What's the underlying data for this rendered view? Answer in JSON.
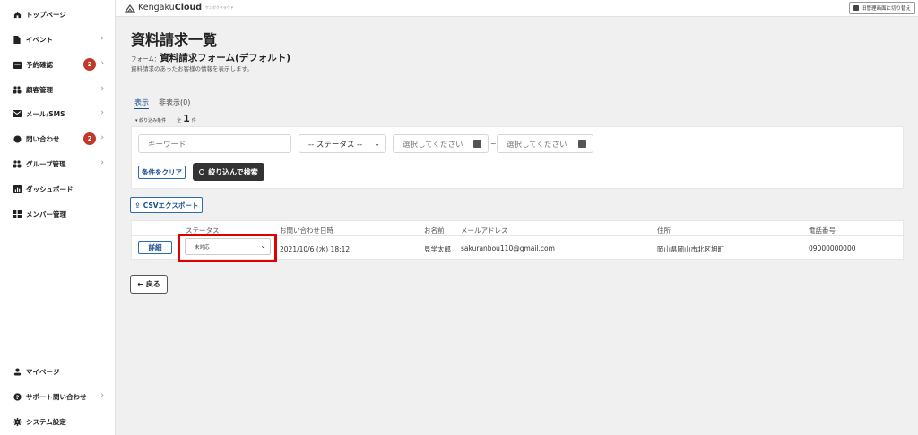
{
  "sidebar": {
    "items": [
      {
        "label": "トップページ",
        "icon": "home-icon"
      },
      {
        "label": "イベント",
        "icon": "document-icon"
      },
      {
        "label": "予約確認",
        "icon": "calendar-icon",
        "badge": "2"
      },
      {
        "label": "顧客管理",
        "icon": "users-icon"
      },
      {
        "label": "メール/SMS",
        "icon": "mail-icon"
      },
      {
        "label": "問い合わせ",
        "icon": "inquiry-icon",
        "badge": "2"
      },
      {
        "label": "グループ管理",
        "icon": "group-icon"
      },
      {
        "label": "ダッシュボード",
        "icon": "dashboard-icon"
      },
      {
        "label": "メンバー管理",
        "icon": "members-icon"
      }
    ],
    "bottom_items": [
      {
        "label": "マイページ",
        "icon": "person-icon"
      },
      {
        "label": "サポート問い合わせ",
        "icon": "help-icon"
      },
      {
        "label": "システム設定",
        "icon": "gear-icon"
      }
    ],
    "chevron": "›"
  },
  "header": {
    "brand_regular": "Kengaku",
    "brand_bold": "Cloud",
    "brand_kana": "ケンガククラウド",
    "switch_label": "旧管理画面に切り替え"
  },
  "main": {
    "title": "資料請求一覧",
    "form_prefix": "フォーム：",
    "form_name": "資料請求フォーム(デフォルト)",
    "description": "資料請求のあったお客様の情報を表示します。",
    "tabs": [
      {
        "label": "表示"
      },
      {
        "label": "非表示(0)"
      }
    ],
    "filter_toggle": "▾ 絞り込み条件",
    "count_prefix": "全",
    "count": "1",
    "count_suffix": "件",
    "filters": {
      "keyword_placeholder": "キーワード",
      "status_value": "-- ステータス --",
      "date_from_placeholder": "選択してください",
      "date_to_placeholder": "選択してください",
      "tilde": "~",
      "clear_label": "条件をクリア",
      "search_label": "絞り込んで検索"
    },
    "csv_label": "CSVエクスポート",
    "table": {
      "headers": [
        "ステータス",
        "お問い合わせ日時",
        "お名前",
        "メールアドレス",
        "住所",
        "電話番号"
      ],
      "rows": [
        {
          "detail_label": "詳細",
          "status": "未対応",
          "datetime": "2021/10/6 (水) 18:12",
          "name": "見学太郎",
          "email": "sakuranbou110@gmail.com",
          "address": "岡山県岡山市北区旭町",
          "phone": "09000000000"
        }
      ]
    },
    "back_label": "← 戻る"
  },
  "colors": {
    "accent": "#1a4f8b",
    "badge": "#c0392b",
    "highlight": "#e00000"
  }
}
